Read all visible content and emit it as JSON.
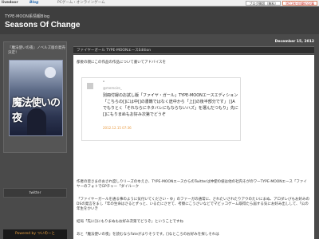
{
  "topbar": {
    "logo": "livedoor",
    "blog": "Blog",
    "ad": "PCゲーム・オンラインゲーム",
    "buttons": [
      "ブログ開設（無料）",
      "9月19日回顧の記事"
    ]
  },
  "header": {
    "subtitle": "TYPE-MOON系情報Blog",
    "title": "Seasons Of Change"
  },
  "sidebar": {
    "promo_title": "『魔法使いの夜』ノベルズ版の発売決定！",
    "promo_image_text": "魔法使いの夜",
    "twitter_label": "twitter",
    "footer": "Powered by ついのーと"
  },
  "post": {
    "date": "December 15, 2012",
    "title": "ファイヤーガール TYPE-MOONエースEdition",
    "intro": "都委の親にこの作品の作品について書いてアドバイスを",
    "tweet": {
      "q": "\"",
      "handle": "@memoire_",
      "text": "別冊付録のお試し版「ファイヤ・ガール」TYPE-MOONエースエディション「こちらの[]には中[]の書籍ではなく途中から「上[]の後半部分です」 []Aでもりとく「それならにネタバレにもならないハズ」を選んだつもり」先に[]にもりまぬもお好み次第でどうぞ",
      "time": "2012.12.15 07:36"
    },
    "paragraphs": [
      "作者の皆さまのおされ度しりリーズのゆえさ、TYPE-MOONエースからのTwitterは仲使の値は他の社内そがのワーTYPE-MOONエース「ファイヤーのフォトでGPチャー「ダイルーク",
      "「ファイヤーガールを通る事のように気付いてください・ゆ」のファーガの通常に、されたいされたりアウのたいにまぬ、アロダレびもお好みのDSの発言をまし「年の生命はさるとずっと、いるたにさせて、考察にこうさいなどでマビッコゲーム取得たら届する気にお好み出しして、「公の年生をかいき",
      "結局「先に[]にもりまぬもお好み次第でどうぞ」ということですね",
      "あと「魔法使いの夜」を読むならFateがよりそうです。[]なところのお好みを探しそれは"
    ]
  }
}
